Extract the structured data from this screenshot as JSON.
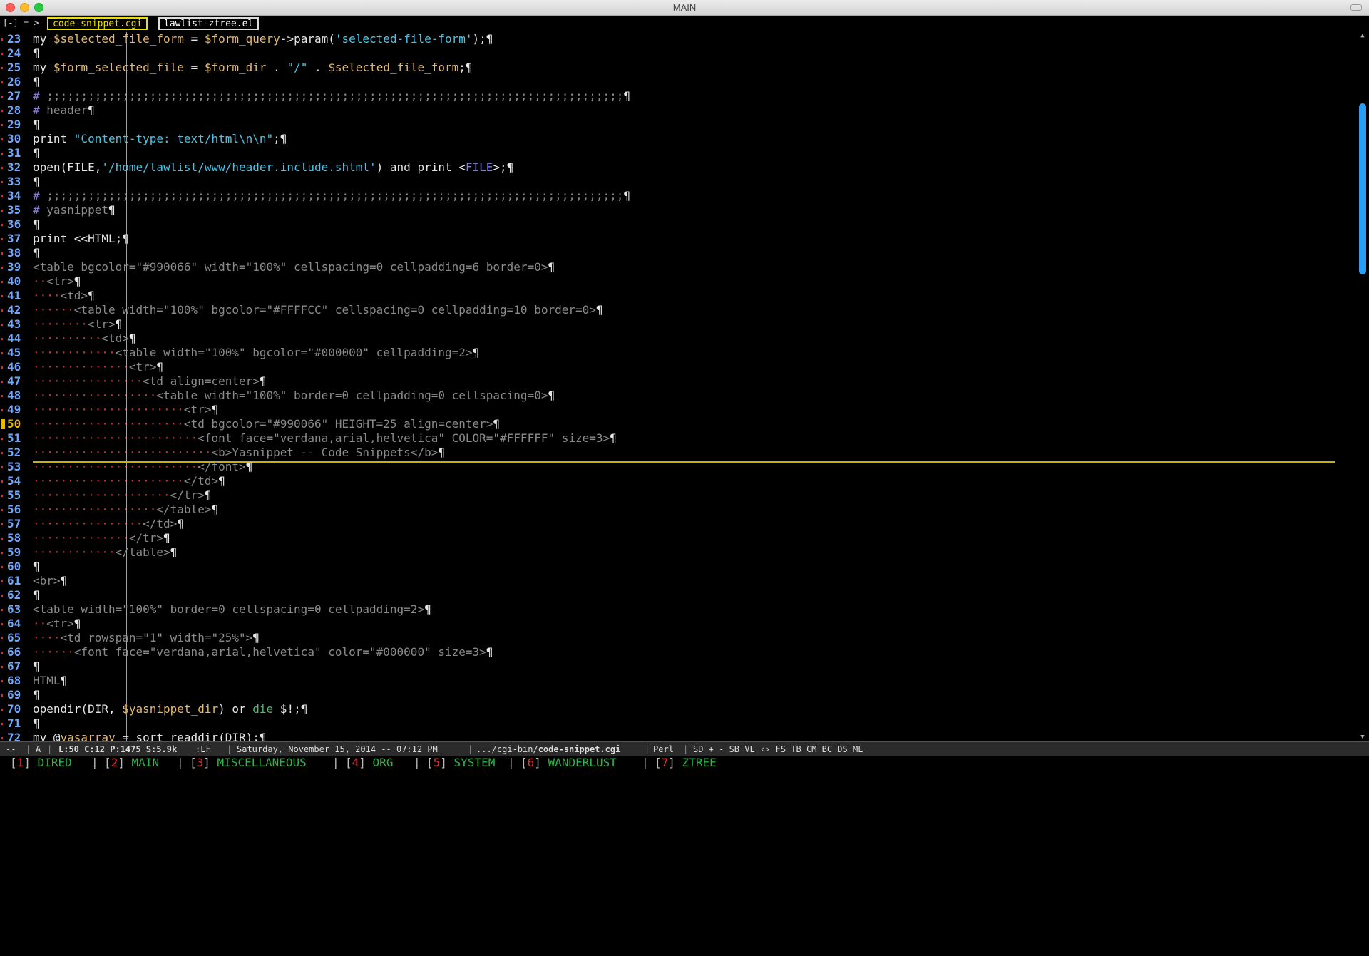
{
  "window": {
    "title": "MAIN"
  },
  "tabbar": {
    "prefix": "[-] = >",
    "tabs": [
      {
        "label": "code-snippet.cgi",
        "active": true
      },
      {
        "label": "lawlist-ztree.el",
        "active": false
      }
    ]
  },
  "editor": {
    "current_line": 50,
    "lines": [
      {
        "n": "23",
        "segs": [
          [
            "kw",
            "my "
          ],
          [
            "var",
            "$selected_file_form"
          ],
          [
            "kw",
            " = "
          ],
          [
            "var",
            "$form_query"
          ],
          [
            "kw",
            "->param("
          ],
          [
            "str",
            "'selected-file-form'"
          ],
          [
            "kw",
            ");¶"
          ]
        ]
      },
      {
        "n": "24",
        "segs": [
          [
            "pil",
            "¶"
          ]
        ]
      },
      {
        "n": "25",
        "segs": [
          [
            "kw",
            "my "
          ],
          [
            "var",
            "$form_selected_file"
          ],
          [
            "kw",
            " = "
          ],
          [
            "var",
            "$form_dir"
          ],
          [
            "kw",
            " . "
          ],
          [
            "str",
            "\"/\""
          ],
          [
            "kw",
            " . "
          ],
          [
            "var",
            "$selected_file_form"
          ],
          [
            "kw",
            ";¶"
          ]
        ]
      },
      {
        "n": "26",
        "segs": [
          [
            "pil",
            "¶"
          ]
        ]
      },
      {
        "n": "27",
        "segs": [
          [
            "com",
            "# "
          ],
          [
            "comt",
            ";;;;;;;;;;;;;;;;;;;;;;;;;;;;;;;;;;;;;;;;;;;;;;;;;;;;;;;;;;;;;;;;;;;;;;;;;;;;;;;;;;;;"
          ],
          [
            "pil",
            "¶"
          ]
        ]
      },
      {
        "n": "28",
        "segs": [
          [
            "com",
            "# "
          ],
          [
            "comt",
            "header"
          ],
          [
            "pil",
            "¶"
          ]
        ]
      },
      {
        "n": "29",
        "segs": [
          [
            "pil",
            "¶"
          ]
        ]
      },
      {
        "n": "30",
        "segs": [
          [
            "kw",
            "print "
          ],
          [
            "str",
            "\"Content-type: text/html\\n\\n\""
          ],
          [
            "kw",
            ";¶"
          ]
        ]
      },
      {
        "n": "31",
        "segs": [
          [
            "pil",
            "¶"
          ]
        ]
      },
      {
        "n": "32",
        "segs": [
          [
            "kw",
            "open(FILE,"
          ],
          [
            "str",
            "'/home/lawlist/www/header.include.shtml'"
          ],
          [
            "kw",
            ") and print <"
          ],
          [
            "blue",
            "FILE"
          ],
          [
            "kw",
            ">;¶"
          ]
        ]
      },
      {
        "n": "33",
        "segs": [
          [
            "pil",
            "¶"
          ]
        ]
      },
      {
        "n": "34",
        "segs": [
          [
            "com",
            "# "
          ],
          [
            "comt",
            ";;;;;;;;;;;;;;;;;;;;;;;;;;;;;;;;;;;;;;;;;;;;;;;;;;;;;;;;;;;;;;;;;;;;;;;;;;;;;;;;;;;;"
          ],
          [
            "pil",
            "¶"
          ]
        ]
      },
      {
        "n": "35",
        "segs": [
          [
            "com",
            "# "
          ],
          [
            "comt",
            "yasnippet"
          ],
          [
            "pil",
            "¶"
          ]
        ]
      },
      {
        "n": "36",
        "segs": [
          [
            "pil",
            "¶"
          ]
        ]
      },
      {
        "n": "37",
        "segs": [
          [
            "kw",
            "print <<HTML;¶"
          ]
        ]
      },
      {
        "n": "38",
        "segs": [
          [
            "pil",
            "¶"
          ]
        ]
      },
      {
        "n": "39",
        "segs": [
          [
            "tag",
            "<table bgcolor=\"#990066\" width=\"100%\" cellspacing=0 cellpadding=6 border=0>"
          ],
          [
            "pil",
            "¶"
          ]
        ]
      },
      {
        "n": "40",
        "segs": [
          [
            "dot",
            "··"
          ],
          [
            "tag",
            "<tr>"
          ],
          [
            "pil",
            "¶"
          ]
        ]
      },
      {
        "n": "41",
        "segs": [
          [
            "dot",
            "····"
          ],
          [
            "tag",
            "<td>"
          ],
          [
            "pil",
            "¶"
          ]
        ]
      },
      {
        "n": "42",
        "segs": [
          [
            "dot",
            "······"
          ],
          [
            "tag",
            "<table width=\"100%\" bgcolor=\"#FFFFCC\" cellspacing=0 cellpadding=10 border=0>"
          ],
          [
            "pil",
            "¶"
          ]
        ]
      },
      {
        "n": "43",
        "segs": [
          [
            "dot",
            "········"
          ],
          [
            "tag",
            "<tr>"
          ],
          [
            "pil",
            "¶"
          ]
        ]
      },
      {
        "n": "44",
        "segs": [
          [
            "dot",
            "··········"
          ],
          [
            "tag",
            "<td>"
          ],
          [
            "pil",
            "¶"
          ]
        ]
      },
      {
        "n": "45",
        "segs": [
          [
            "dot",
            "············"
          ],
          [
            "tag",
            "<table width=\"100%\" bgcolor=\"#000000\" cellpadding=2>"
          ],
          [
            "pil",
            "¶"
          ]
        ]
      },
      {
        "n": "46",
        "segs": [
          [
            "dot",
            "··············"
          ],
          [
            "tag",
            "<tr>"
          ],
          [
            "pil",
            "¶"
          ]
        ]
      },
      {
        "n": "47",
        "segs": [
          [
            "dot",
            "················"
          ],
          [
            "tag",
            "<td align=center>"
          ],
          [
            "pil",
            "¶"
          ]
        ]
      },
      {
        "n": "48",
        "segs": [
          [
            "dot",
            "··················"
          ],
          [
            "tag",
            "<table width=\"100%\" border=0 cellpadding=0 cellspacing=0>"
          ],
          [
            "pil",
            "¶"
          ]
        ]
      },
      {
        "n": "49",
        "segs": [
          [
            "dot",
            "······················"
          ],
          [
            "tag",
            "<tr>"
          ],
          [
            "pil",
            "¶"
          ]
        ]
      },
      {
        "n": "50",
        "segs": [
          [
            "dot",
            "······················"
          ],
          [
            "tag",
            "<td bgcolor=\"#990066\" HEIGHT=25 align=center>"
          ],
          [
            "pil",
            "¶"
          ]
        ]
      },
      {
        "n": "51",
        "segs": [
          [
            "dot",
            "························"
          ],
          [
            "tag",
            "<font face=\"verdana,arial,helvetica\" COLOR=\"#FFFFFF\" size=3>"
          ],
          [
            "pil",
            "¶"
          ]
        ]
      },
      {
        "n": "52",
        "segs": [
          [
            "dot",
            "··························"
          ],
          [
            "tag",
            "<b>Yasnippet -- Code Snippets</b>"
          ],
          [
            "pil",
            "¶"
          ]
        ]
      },
      {
        "n": "53",
        "segs": [
          [
            "dot",
            "························"
          ],
          [
            "tag",
            "</font>"
          ],
          [
            "pil",
            "¶"
          ]
        ]
      },
      {
        "n": "54",
        "segs": [
          [
            "dot",
            "······················"
          ],
          [
            "tag",
            "</td>"
          ],
          [
            "pil",
            "¶"
          ]
        ]
      },
      {
        "n": "55",
        "segs": [
          [
            "dot",
            "····················"
          ],
          [
            "tag",
            "</tr>"
          ],
          [
            "pil",
            "¶"
          ]
        ]
      },
      {
        "n": "56",
        "segs": [
          [
            "dot",
            "··················"
          ],
          [
            "tag",
            "</table>"
          ],
          [
            "pil",
            "¶"
          ]
        ]
      },
      {
        "n": "57",
        "segs": [
          [
            "dot",
            "················"
          ],
          [
            "tag",
            "</td>"
          ],
          [
            "pil",
            "¶"
          ]
        ]
      },
      {
        "n": "58",
        "segs": [
          [
            "dot",
            "··············"
          ],
          [
            "tag",
            "</tr>"
          ],
          [
            "pil",
            "¶"
          ]
        ]
      },
      {
        "n": "59",
        "segs": [
          [
            "dot",
            "············"
          ],
          [
            "tag",
            "</table>"
          ],
          [
            "pil",
            "¶"
          ]
        ]
      },
      {
        "n": "60",
        "segs": [
          [
            "pil",
            "¶"
          ]
        ]
      },
      {
        "n": "61",
        "segs": [
          [
            "tag",
            "<br>"
          ],
          [
            "pil",
            "¶"
          ]
        ]
      },
      {
        "n": "62",
        "segs": [
          [
            "pil",
            "¶"
          ]
        ]
      },
      {
        "n": "63",
        "segs": [
          [
            "tag",
            "<table width=\"100%\" border=0 cellspacing=0 cellpadding=2>"
          ],
          [
            "pil",
            "¶"
          ]
        ]
      },
      {
        "n": "64",
        "segs": [
          [
            "dot",
            "··"
          ],
          [
            "tag",
            "<tr>"
          ],
          [
            "pil",
            "¶"
          ]
        ]
      },
      {
        "n": "65",
        "segs": [
          [
            "dot",
            "····"
          ],
          [
            "tag",
            "<td rowspan=\"1\" width=\"25%\">"
          ],
          [
            "pil",
            "¶"
          ]
        ]
      },
      {
        "n": "66",
        "segs": [
          [
            "dot",
            "······"
          ],
          [
            "tag",
            "<font face=\"verdana,arial,helvetica\" color=\"#000000\" size=3>"
          ],
          [
            "pil",
            "¶"
          ]
        ]
      },
      {
        "n": "67",
        "segs": [
          [
            "pil",
            "¶"
          ]
        ]
      },
      {
        "n": "68",
        "segs": [
          [
            "tag",
            "HTML"
          ],
          [
            "pil",
            "¶"
          ]
        ]
      },
      {
        "n": "69",
        "segs": [
          [
            "pil",
            "¶"
          ]
        ]
      },
      {
        "n": "70",
        "segs": [
          [
            "kw",
            "opendir(DIR, "
          ],
          [
            "var",
            "$yasnippet_dir"
          ],
          [
            "kw",
            ") or "
          ],
          [
            "grn",
            "die"
          ],
          [
            "kw",
            " $!;¶"
          ]
        ]
      },
      {
        "n": "71",
        "segs": [
          [
            "pil",
            "¶"
          ]
        ]
      },
      {
        "n": "72",
        "segs": [
          [
            "kw",
            "my @"
          ],
          [
            "var",
            "yasarray"
          ],
          [
            "kw",
            " = sort readdir(DIR);¶"
          ]
        ]
      }
    ]
  },
  "modeline": {
    "flags": "--",
    "mode_letter": "A",
    "position": "L:50 C:12 P:1475 S:5.9k",
    "eol": ":LF",
    "datetime": "Saturday, November 15, 2014 -- 07:12 PM",
    "path_prefix": ".../cgi-bin/",
    "path_file": "code-snippet.cgi",
    "major_mode": "Perl",
    "minor_modes": "SD + - SB VL ‹› FS TB CM BC DS ML"
  },
  "frames": [
    {
      "num": "1",
      "name": "DIRED"
    },
    {
      "num": "2",
      "name": "MAIN"
    },
    {
      "num": "3",
      "name": "MISCELLANEOUS"
    },
    {
      "num": "4",
      "name": "ORG"
    },
    {
      "num": "5",
      "name": "SYSTEM"
    },
    {
      "num": "6",
      "name": "WANDERLUST"
    },
    {
      "num": "7",
      "name": "ZTREE"
    }
  ]
}
